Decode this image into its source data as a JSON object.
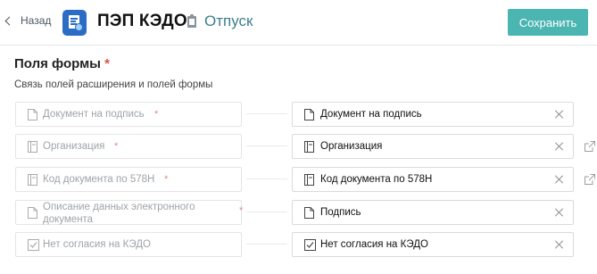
{
  "header": {
    "back_label": "Назад",
    "app_title": "ПЭП КЭДО",
    "doc_type": "Отпуск",
    "save_label": "Сохранить"
  },
  "section": {
    "title": "Поля формы",
    "required_mark": "*",
    "subtitle": "Связь полей расширения и полей формы"
  },
  "rows": [
    {
      "source_label": "Документ на подпись",
      "source_required": "*",
      "source_icon": "document-icon",
      "target_label": "Документ на подпись",
      "target_icon": "document-icon",
      "external_link": false
    },
    {
      "source_label": "Организация",
      "source_required": "*",
      "source_icon": "reference-book-icon",
      "target_label": "Организация",
      "target_icon": "reference-book-icon",
      "external_link": true
    },
    {
      "source_label": "Код документа по 578Н",
      "source_required": "*",
      "source_icon": "reference-book-icon",
      "target_label": "Код документа по 578Н",
      "target_icon": "reference-book-icon",
      "external_link": true
    },
    {
      "source_label": "Описание данных электронного документа",
      "source_required": "*",
      "source_icon": "document-icon",
      "target_label": "Подпись",
      "target_icon": "document-icon",
      "external_link": false
    },
    {
      "source_label": "Нет согласия на КЭДО",
      "source_required": "",
      "source_icon": "checkbox-icon",
      "target_label": "Нет согласия на КЭДО",
      "target_icon": "checkbox-icon",
      "external_link": false
    }
  ],
  "colors": {
    "accent": "#4bb5b1",
    "app_icon": "#2b6cc4",
    "doc_type_text": "#3a7f8c",
    "required": "#d9534f"
  }
}
